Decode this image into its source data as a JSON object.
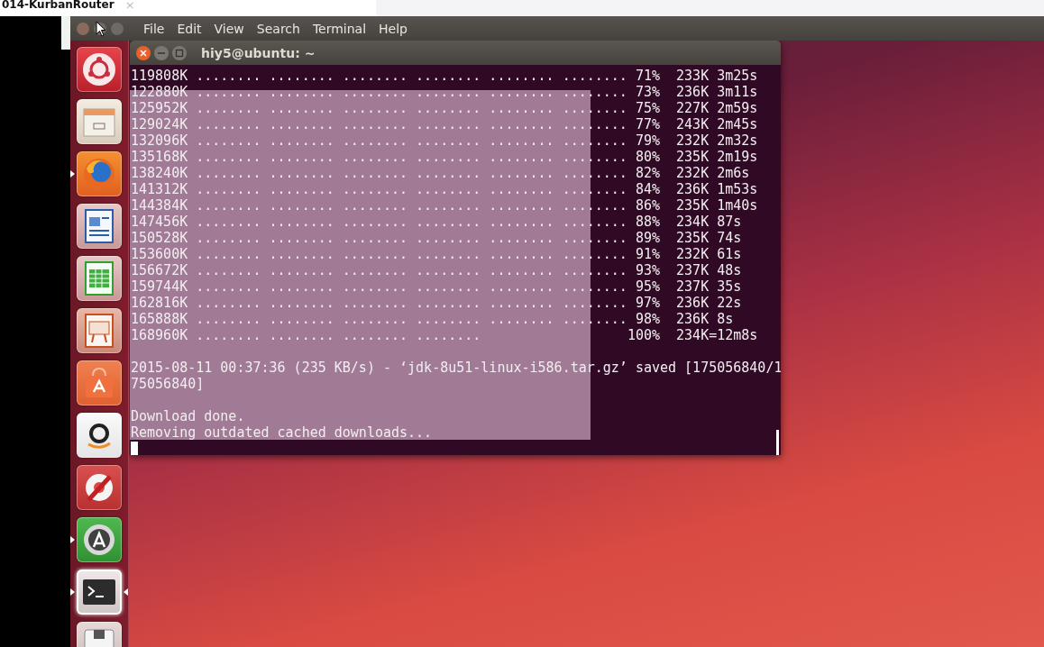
{
  "browser_tab": {
    "title": "014-KurbanRouter",
    "close": "×"
  },
  "menu_bar": [
    "File",
    "Edit",
    "View",
    "Search",
    "Terminal",
    "Help"
  ],
  "launcher": [
    {
      "kind": "dash",
      "running": false,
      "focused": false
    },
    {
      "kind": "files",
      "running": false,
      "focused": false
    },
    {
      "kind": "firefox",
      "running": true,
      "focused": false
    },
    {
      "kind": "writer",
      "running": false,
      "focused": false
    },
    {
      "kind": "calc",
      "running": false,
      "focused": false
    },
    {
      "kind": "impress",
      "running": false,
      "focused": false
    },
    {
      "kind": "software",
      "running": false,
      "focused": false
    },
    {
      "kind": "amazon",
      "running": false,
      "focused": false
    },
    {
      "kind": "settings",
      "running": false,
      "focused": false
    },
    {
      "kind": "updater",
      "running": true,
      "focused": false
    },
    {
      "kind": "terminal",
      "running": true,
      "focused": true
    },
    {
      "kind": "drive",
      "running": false,
      "focused": false
    }
  ],
  "terminal": {
    "title": "hiy5@ubuntu: ~",
    "blocks": [
      [
        "119808K ........ ........ ........ ........ ........ ........ 71%  233K 3m25s",
        "122880K ........ ........ ........ ........ ........ ........ 73%  236K 3m11s",
        "125952K ........ ........ ........ ........ ........ ........ 75%  227K 2m59s",
        "129024K ........ ........ ........ ........ ........ ........ 77%  243K 2m45s",
        "132096K ........ ........ ........ ........ ........ ........ 79%  232K 2m32s",
        "135168K ........ ........ ........ ........ ........ ........ 80%  235K 2m19s",
        "138240K ........ ........ ........ ........ ........ ........ 82%  232K 2m6s",
        "141312K ........ ........ ........ ........ ........ ........ 84%  236K 1m53s",
        "144384K ........ ........ ........ ........ ........ ........ 86%  235K 1m40s",
        "147456K ........ ........ ........ ........ ........ ........ 88%  234K 87s",
        "150528K ........ ........ ........ ........ ........ ........ 89%  235K 74s",
        "153600K ........ ........ ........ ........ ........ ........ 91%  232K 61s",
        "156672K ........ ........ ........ ........ ........ ........ 93%  237K 48s",
        "159744K ........ ........ ........ ........ ........ ........ 95%  237K 35s",
        "162816K ........ ........ ........ ........ ........ ........ 97%  236K 22s",
        "165888K ........ ........ ........ ........ ........ ........ 98%  236K 8s",
        "168960K ........ ........ ........ ........                  100%  234K=12m8s"
      ],
      [
        "2015-08-11 00:37:36 (235 KB/s) - ‘jdk-8u51-linux-i586.tar.gz’ saved [175056840/1",
        "75056840]"
      ],
      [
        "Download done.",
        "Removing outdated cached downloads..."
      ]
    ]
  }
}
